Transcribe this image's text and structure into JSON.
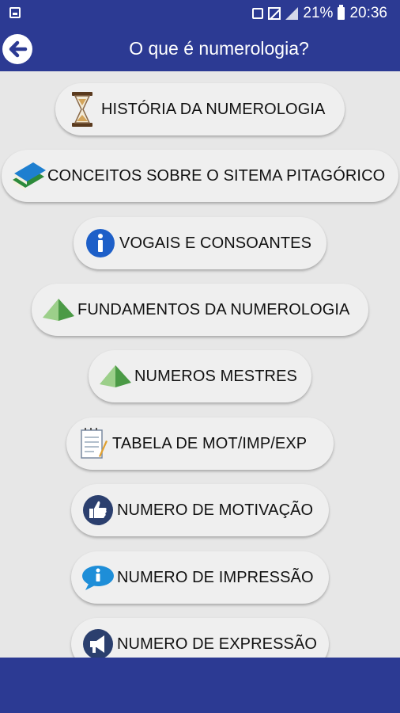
{
  "status_bar": {
    "battery": "21%",
    "time": "20:36"
  },
  "app_bar": {
    "title": "O que é numerologia?"
  },
  "menu": {
    "items": [
      {
        "label": "HISTÓRIA DA NUMEROLOGIA",
        "icon": "hourglass-icon"
      },
      {
        "label": "CONCEITOS SOBRE O SITEMA PITAGÓRICO",
        "icon": "books-icon"
      },
      {
        "label": "VOGAIS E CONSOANTES",
        "icon": "info-icon"
      },
      {
        "label": "FUNDAMENTOS DA NUMEROLOGIA",
        "icon": "pyramid-icon"
      },
      {
        "label": "NUMEROS MESTRES",
        "icon": "pyramid-icon"
      },
      {
        "label": "TABELA DE MOT/IMP/EXP",
        "icon": "notepad-icon"
      },
      {
        "label": "NUMERO DE MOTIVAÇÃO",
        "icon": "thumbs-up-icon"
      },
      {
        "label": "NUMERO DE IMPRESSÃO",
        "icon": "info-bubble-icon"
      },
      {
        "label": "NUMERO DE EXPRESSÃO",
        "icon": "megaphone-icon"
      }
    ]
  },
  "colors": {
    "primary": "#2c3a93",
    "background": "#e7e7e7",
    "button": "#efefef"
  }
}
